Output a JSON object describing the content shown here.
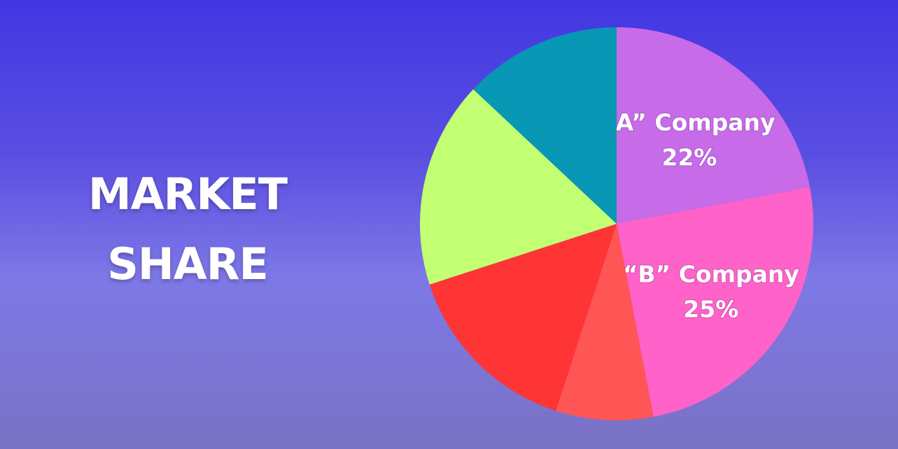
{
  "title": {
    "line1": "MARKET",
    "line2": "SHARE"
  },
  "chart_data": {
    "type": "pie",
    "start_angle_deg": 0,
    "direction": "clockwise",
    "slices": [
      {
        "label": "“A” Company",
        "value_label": "22%",
        "value": 22,
        "color": "#c86be8",
        "labeled": true
      },
      {
        "label": "“B” Company",
        "value_label": "25%",
        "value": 25,
        "color": "#ff62c8",
        "labeled": true
      },
      {
        "label": "",
        "value_label": "",
        "value": 8,
        "color": "#ff5555",
        "labeled": false
      },
      {
        "label": "",
        "value_label": "",
        "value": 15,
        "color": "#ff3434",
        "labeled": false
      },
      {
        "label": "",
        "value_label": "",
        "value": 17,
        "color": "#c2ff72",
        "labeled": false
      },
      {
        "label": "",
        "value_label": "",
        "value": 13,
        "color": "#0897b4",
        "labeled": false
      }
    ]
  }
}
